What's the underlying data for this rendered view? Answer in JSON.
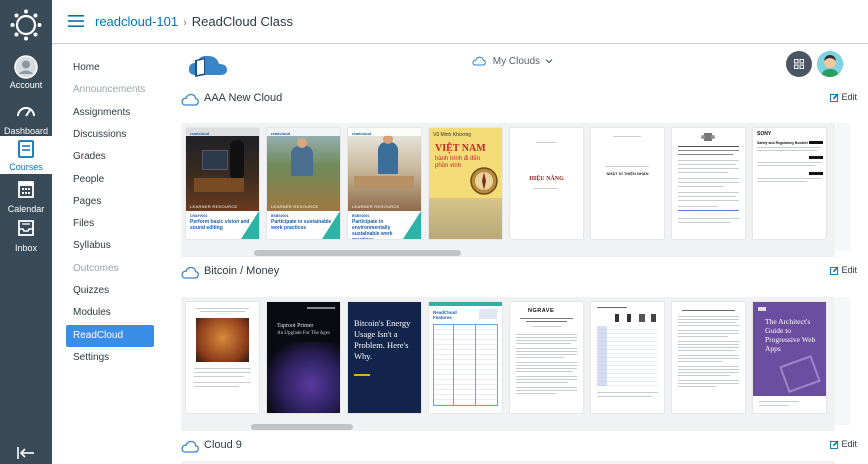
{
  "global_nav": {
    "account": "Account",
    "dashboard": "Dashboard",
    "courses": "Courses",
    "calendar": "Calendar",
    "inbox": "Inbox"
  },
  "breadcrumb": {
    "course": "readcloud-101",
    "separator": "›",
    "page": "ReadCloud Class"
  },
  "course_nav": [
    {
      "label": "Home",
      "state": "normal"
    },
    {
      "label": "Announcements",
      "state": "disabled"
    },
    {
      "label": "Assignments",
      "state": "normal"
    },
    {
      "label": "Discussions",
      "state": "normal"
    },
    {
      "label": "Grades",
      "state": "normal"
    },
    {
      "label": "People",
      "state": "normal"
    },
    {
      "label": "Pages",
      "state": "normal"
    },
    {
      "label": "Files",
      "state": "normal"
    },
    {
      "label": "Syllabus",
      "state": "normal"
    },
    {
      "label": "Outcomes",
      "state": "disabled"
    },
    {
      "label": "Quizzes",
      "state": "normal"
    },
    {
      "label": "Modules",
      "state": "normal"
    },
    {
      "label": "ReadCloud",
      "state": "active"
    },
    {
      "label": "Settings",
      "state": "normal"
    }
  ],
  "toolbar": {
    "my_clouds": "My Clouds"
  },
  "sections": [
    {
      "title": "AAA New Cloud",
      "edit": "Edit"
    },
    {
      "title": "Bitcoin / Money",
      "edit": "Edit"
    },
    {
      "title": "Cloud 9",
      "edit": "Edit"
    }
  ],
  "books_aaa": [
    {
      "brand": "readcloud",
      "code": "CHAF0001",
      "title": "Perform basic vision and sound editing",
      "tag": "LEARNER RESOURCE"
    },
    {
      "brand": "readcloud",
      "code": "BSBS0001",
      "title": "Participate in sustainable work practices",
      "tag": "LEARNER RESOURCE"
    },
    {
      "brand": "readcloud",
      "code": "BSBS0001",
      "title": "Participate in environmentally sustainable work practices",
      "tag": "LEARNER RESOURCE"
    },
    {
      "author": "Vũ Minh Khương",
      "title1": "VIỆT NAM",
      "title2": "hành trình đi đến phồn vinh"
    },
    {
      "title": "HIỆU NĂNG"
    },
    {
      "title": "NHẬT KÍ THIỆN NHÂN"
    },
    {
      "title": ""
    },
    {
      "brand": "SONY",
      "heading": "Safety and Regulatory Booklet"
    }
  ],
  "books_bitcoin": [
    {
      "title": ""
    },
    {
      "title": "Taproot Primer",
      "subtitle": "An Upgrade For The Ages"
    },
    {
      "title": "Bitcoin's Energy Usage Isn't a Problem. Here's Why."
    },
    {
      "title": "ReadCloud Features"
    },
    {
      "brand": "NGRAVE"
    },
    {
      "title": ""
    },
    {
      "title": ""
    },
    {
      "title": "The Architect's Guide to Progressive Web Apps"
    }
  ],
  "colors": {
    "global_nav_bg": "#394b58",
    "link": "#0374b5",
    "active_nav": "#3b8ee8",
    "learner_teal": "#2bb3a6"
  }
}
